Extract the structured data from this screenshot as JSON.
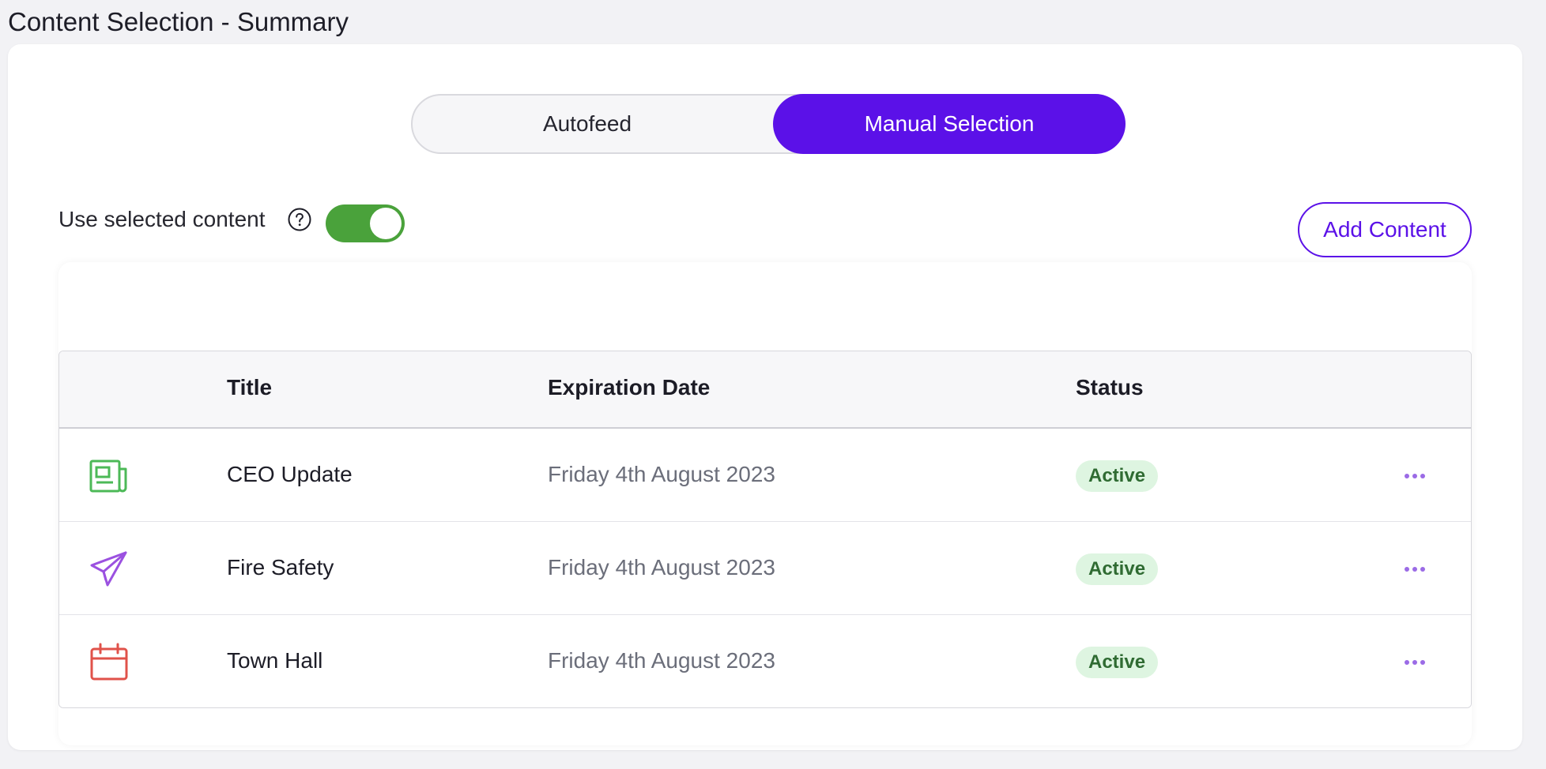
{
  "page": {
    "title": "Content Selection - Summary"
  },
  "segmented": {
    "autofeed_label": "Autofeed",
    "manual_label": "Manual Selection",
    "selected": "Manual Selection"
  },
  "toggle": {
    "label": "Use selected content",
    "help_icon": "question-circle-icon",
    "on": true
  },
  "actions": {
    "add_content_label": "Add Content"
  },
  "table": {
    "headers": {
      "icon": "",
      "title": "Title",
      "expiration": "Expiration Date",
      "status": "Status"
    },
    "rows": [
      {
        "icon": "newspaper-icon",
        "icon_color": "#4cb957",
        "title": "CEO Update",
        "expiration": "Friday 4th August 2023",
        "status": "Active"
      },
      {
        "icon": "paper-plane-icon",
        "icon_color": "#9b51e0",
        "title": "Fire Safety",
        "expiration": "Friday 4th August 2023",
        "status": "Active"
      },
      {
        "icon": "calendar-icon",
        "icon_color": "#e0524a",
        "title": "Town Hall",
        "expiration": "Friday 4th August 2023",
        "status": "Active"
      }
    ]
  },
  "colors": {
    "accent": "#5b11e8",
    "toggle_on": "#4aa23b",
    "badge_bg": "#def5e1",
    "badge_text": "#2f6b32",
    "more_dots": "#9b6be6"
  }
}
